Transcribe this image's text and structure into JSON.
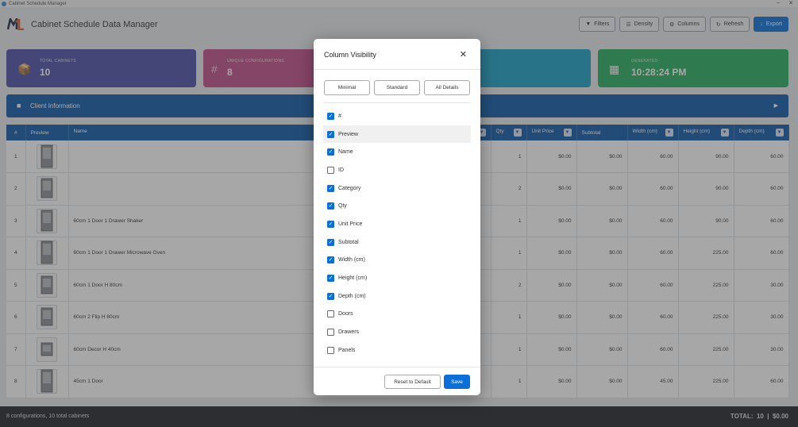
{
  "window": {
    "title": "Cabinet Schedule Manager",
    "controls": [
      "–",
      "✕"
    ]
  },
  "header": {
    "title": "Cabinet Schedule Data Manager",
    "buttons": [
      {
        "icon": "filter-icon",
        "glyph": "▼",
        "label": "Filters"
      },
      {
        "icon": "density-icon",
        "glyph": "☰",
        "label": "Density"
      },
      {
        "icon": "columns-icon",
        "glyph": "⚙",
        "label": "Columns"
      },
      {
        "icon": "refresh-icon",
        "glyph": "↻",
        "label": "Refresh"
      },
      {
        "icon": "export-icon",
        "glyph": "↓",
        "label": "Export"
      }
    ]
  },
  "stats": [
    {
      "label": "TOTAL CABINETS",
      "value": "10",
      "icon": "box-icon",
      "glyph": "📦"
    },
    {
      "label": "UNIQUE CONFIGURATIONS",
      "value": "8",
      "icon": "hash-icon",
      "glyph": "#"
    },
    {
      "label": "",
      "value": "",
      "icon": "",
      "glyph": ""
    },
    {
      "label": "GENERATED",
      "value": "10:28:24 PM",
      "icon": "calendar-icon",
      "glyph": "▦"
    }
  ],
  "client": {
    "label": "Client Information",
    "icon": "user-icon",
    "arrow": "▶"
  },
  "table": {
    "columns": [
      "#",
      "Preview",
      "Name",
      "Qty",
      "Unit Price",
      "Subtotal",
      "Width (cm)",
      "Height (cm)",
      "Depth (cm)"
    ],
    "rows": [
      {
        "n": "1",
        "name": "",
        "qty": "1",
        "unit": "$0.00",
        "sub": "$0.00",
        "w": "60.00",
        "h": "90.00",
        "d": "60.00"
      },
      {
        "n": "2",
        "name": "",
        "qty": "2",
        "unit": "$0.00",
        "sub": "$0.00",
        "w": "60.00",
        "h": "90.00",
        "d": "60.00"
      },
      {
        "n": "3",
        "name": "60cm 1 Door 1 Drawer Shaker",
        "qty": "1",
        "unit": "$0.00",
        "sub": "$0.00",
        "w": "60.00",
        "h": "90.00",
        "d": "60.00"
      },
      {
        "n": "4",
        "name": "60cm 1 Door 1 Drawer Microwave Oven",
        "qty": "1",
        "unit": "$0.00",
        "sub": "$0.00",
        "w": "60.00",
        "h": "225.00",
        "d": "60.00"
      },
      {
        "n": "5",
        "name": "60cm 1 Door H 80cm",
        "qty": "2",
        "unit": "$0.00",
        "sub": "$0.00",
        "w": "60.00",
        "h": "225.00",
        "d": "30.00"
      },
      {
        "n": "6",
        "name": "60cm 2 Flip H 80cm",
        "qty": "1",
        "unit": "$0.00",
        "sub": "$0.00",
        "w": "60.00",
        "h": "225.00",
        "d": "30.00"
      },
      {
        "n": "7",
        "name": "60cm Decor H 40cm",
        "qty": "1",
        "unit": "$0.00",
        "sub": "$0.00",
        "w": "60.00",
        "h": "225.00",
        "d": "30.00"
      },
      {
        "n": "8",
        "name": "45cm 1 Door",
        "qty": "1",
        "unit": "$0.00",
        "sub": "$0.00",
        "w": "45.00",
        "h": "225.00",
        "d": "60.00"
      }
    ]
  },
  "footer": {
    "summary": "8 configurations, 10 total cabinets",
    "total": "TOTAL:  10  |  $0.00"
  },
  "modal": {
    "title": "Column Visibility",
    "close": "✕",
    "presets": [
      "Minimal",
      "Standard",
      "All Details"
    ],
    "options": [
      {
        "label": "#",
        "checked": true
      },
      {
        "label": "Preview",
        "checked": true
      },
      {
        "label": "Name",
        "checked": true
      },
      {
        "label": "ID",
        "checked": false
      },
      {
        "label": "Category",
        "checked": true
      },
      {
        "label": "Qty",
        "checked": true
      },
      {
        "label": "Unit Price",
        "checked": true
      },
      {
        "label": "Subtotal",
        "checked": true
      },
      {
        "label": "Width (cm)",
        "checked": true
      },
      {
        "label": "Height (cm)",
        "checked": true
      },
      {
        "label": "Depth (cm)",
        "checked": true
      },
      {
        "label": "Doors",
        "checked": false
      },
      {
        "label": "Drawers",
        "checked": false
      },
      {
        "label": "Panels",
        "checked": false
      }
    ],
    "reset_label": "Reset to Default",
    "save_label": "Save"
  },
  "colors": {
    "accent": "#0a6fd8",
    "header_blue": "#0e5aa8",
    "stat1": "#4a4fa8",
    "stat2": "#c24d8a",
    "stat3": "#1aa0c8",
    "stat4": "#27ae60"
  }
}
